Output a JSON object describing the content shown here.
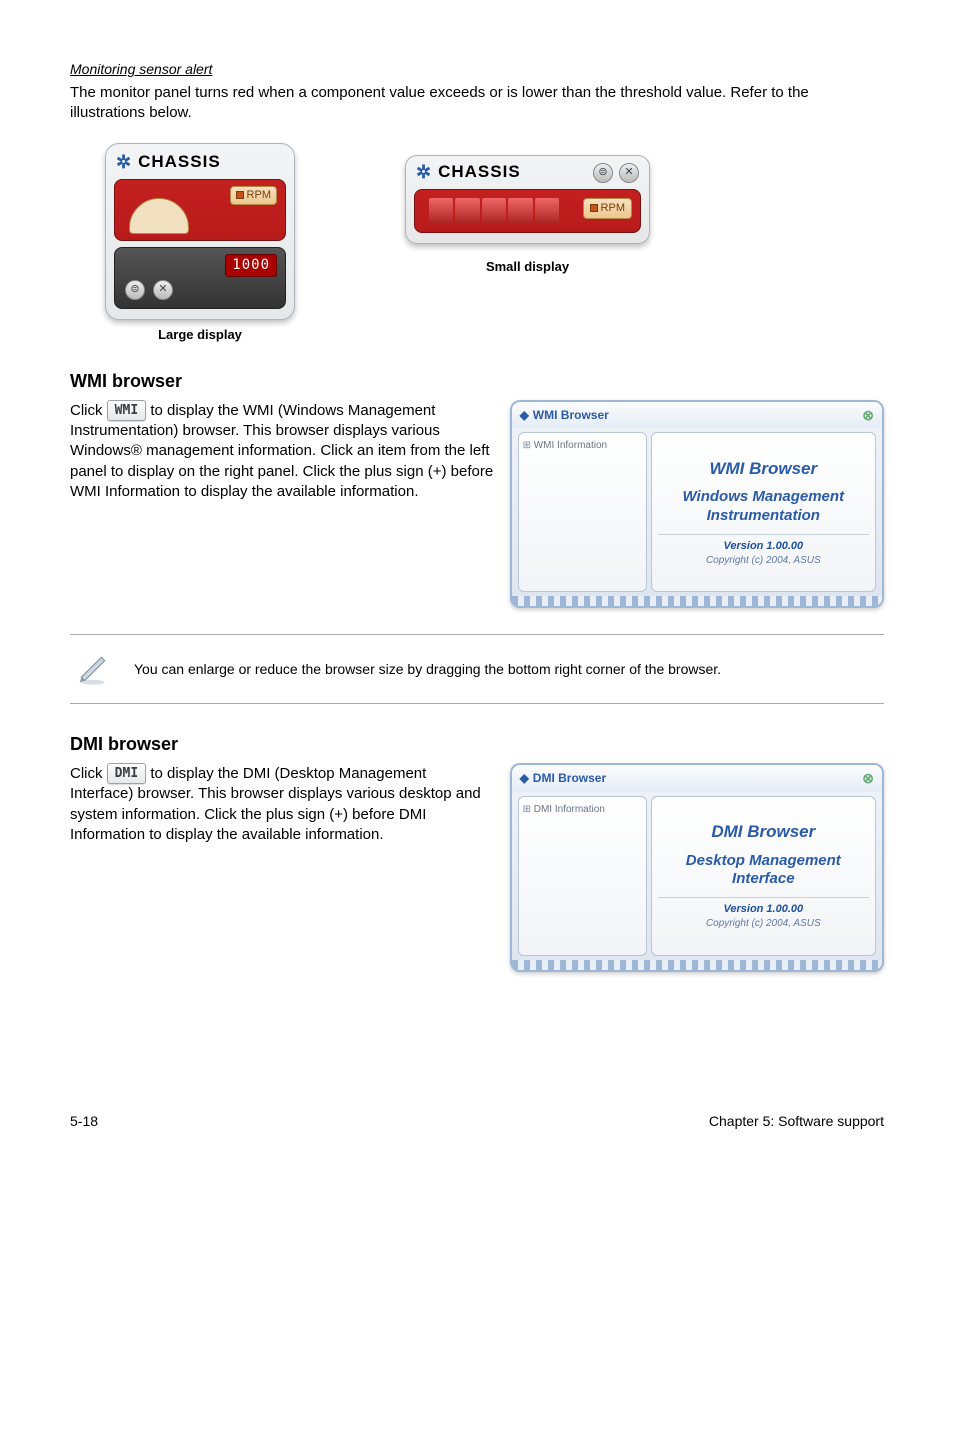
{
  "monitoring": {
    "heading": "Monitoring sensor alert",
    "body": "The monitor panel turns red when a component value exceeds or is lower than the threshold value. Refer to the illustrations below.",
    "chassis_label": "CHASSIS",
    "rpm_label": "RPM",
    "digital_value": "1000",
    "large_caption": "Large display",
    "small_caption": "Small display"
  },
  "wmi": {
    "heading": "WMI browser",
    "button_text": "WMI",
    "para_prefix": "Click ",
    "para_rest": " to display the WMI (Windows Management Instrumentation) browser. This browser displays various Windows® management information. Click an item from the left panel to display on the right panel. Click the plus sign (+) before WMI Information to display the available information.",
    "window_title": "WMI Browser",
    "tree_root": "WMI Information",
    "main_title": "WMI Browser",
    "main_sub1": "Windows Management",
    "main_sub2": "Instrumentation",
    "version": "Version 1.00.00",
    "copyright": "Copyright (c) 2004,  ASUS"
  },
  "note": {
    "text": "You can enlarge or reduce the browser size by dragging the bottom right corner of the browser."
  },
  "dmi": {
    "heading": "DMI browser",
    "button_text": "DMI",
    "para_prefix": "Click ",
    "para_rest": " to display the DMI (Desktop Management Interface) browser. This browser displays various desktop and system information. Click the plus sign (+) before DMI Information to display the available information.",
    "window_title": "DMI Browser",
    "tree_root": "DMI Information",
    "main_title": "DMI Browser",
    "main_sub1": "Desktop Management",
    "main_sub2": "Interface",
    "version": "Version 1.00.00",
    "copyright": "Copyright (c) 2004,  ASUS"
  },
  "footer": {
    "left": "5-18",
    "right": "Chapter 5: Software support"
  }
}
